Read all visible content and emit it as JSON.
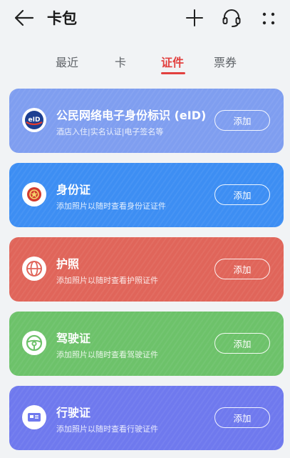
{
  "header": {
    "title": "卡包",
    "icons": [
      "arrow-back-icon",
      "plus-icon",
      "headset-icon",
      "more-dots-icon"
    ]
  },
  "tabs": [
    {
      "label": "最近",
      "active": false
    },
    {
      "label": "卡",
      "active": false
    },
    {
      "label": "证件",
      "active": true
    },
    {
      "label": "票券",
      "active": false
    }
  ],
  "cards": [
    {
      "title": "公民网络电子身份标识 (eID)",
      "subtitle": "酒店入住|实名认证|电子签名等",
      "button": "添加",
      "icon": "eid-logo-icon",
      "icon_text": "eID",
      "color": "#7f9ef0"
    },
    {
      "title": "身份证",
      "subtitle": "添加照片以随时查看身份证证件",
      "button": "添加",
      "icon": "national-emblem-icon",
      "color": "#3d8ef3"
    },
    {
      "title": "护照",
      "subtitle": "添加照片以随时查看护照证件",
      "button": "添加",
      "icon": "globe-icon",
      "color": "#e0655a"
    },
    {
      "title": "驾驶证",
      "subtitle": "添加照片以随时查看驾驶证件",
      "button": "添加",
      "icon": "steering-wheel-icon",
      "color": "#6dc26a"
    },
    {
      "title": "行驶证",
      "subtitle": "添加照片以随时查看行驶证件",
      "button": "添加",
      "icon": "vehicle-license-icon",
      "color": "#6f79ee"
    }
  ]
}
